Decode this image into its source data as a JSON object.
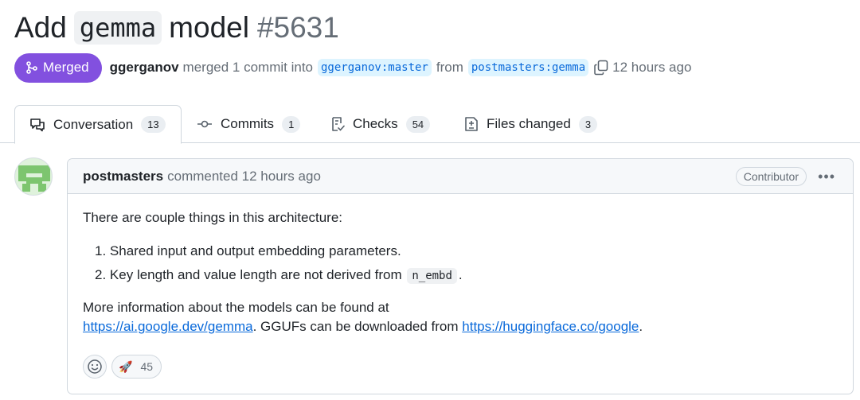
{
  "pr": {
    "title_prefix": "Add",
    "title_code": "gemma",
    "title_suffix": "model",
    "number": "#5631"
  },
  "meta": {
    "status": "Merged",
    "author": "ggerganov",
    "action": "merged 1 commit into",
    "base_branch": "ggerganov:master",
    "from_text": "from",
    "head_branch": "postmasters:gemma",
    "time": "12 hours ago"
  },
  "tabs": [
    {
      "label": "Conversation",
      "count": "13",
      "icon": "comment-discussion-icon"
    },
    {
      "label": "Commits",
      "count": "1",
      "icon": "git-commit-icon"
    },
    {
      "label": "Checks",
      "count": "54",
      "icon": "checklist-icon"
    },
    {
      "label": "Files changed",
      "count": "3",
      "icon": "file-diff-icon"
    }
  ],
  "comment": {
    "author": "postmasters",
    "action": "commented 12 hours ago",
    "role": "Contributor",
    "intro": "There are couple things in this architecture:",
    "items": [
      {
        "num": "1.",
        "text": "Shared input and output embedding parameters."
      },
      {
        "num": "2.",
        "text": "Key length and value length are not derived from",
        "code": "n_embd",
        "after": "."
      }
    ],
    "more_line1": "More information about the models can be found at",
    "link1": "https://ai.google.dev/gemma",
    "mid_text": ". GGUFs can be downloaded from ",
    "link2": "https://huggingface.co/google",
    "end_text": ".",
    "reaction_emoji": "🚀",
    "reaction_count": "45"
  },
  "colors": {
    "merged": "#8250df",
    "link": "#0969da",
    "branch_bg": "#ddf4ff",
    "avatar_green": "#7dc56f"
  }
}
